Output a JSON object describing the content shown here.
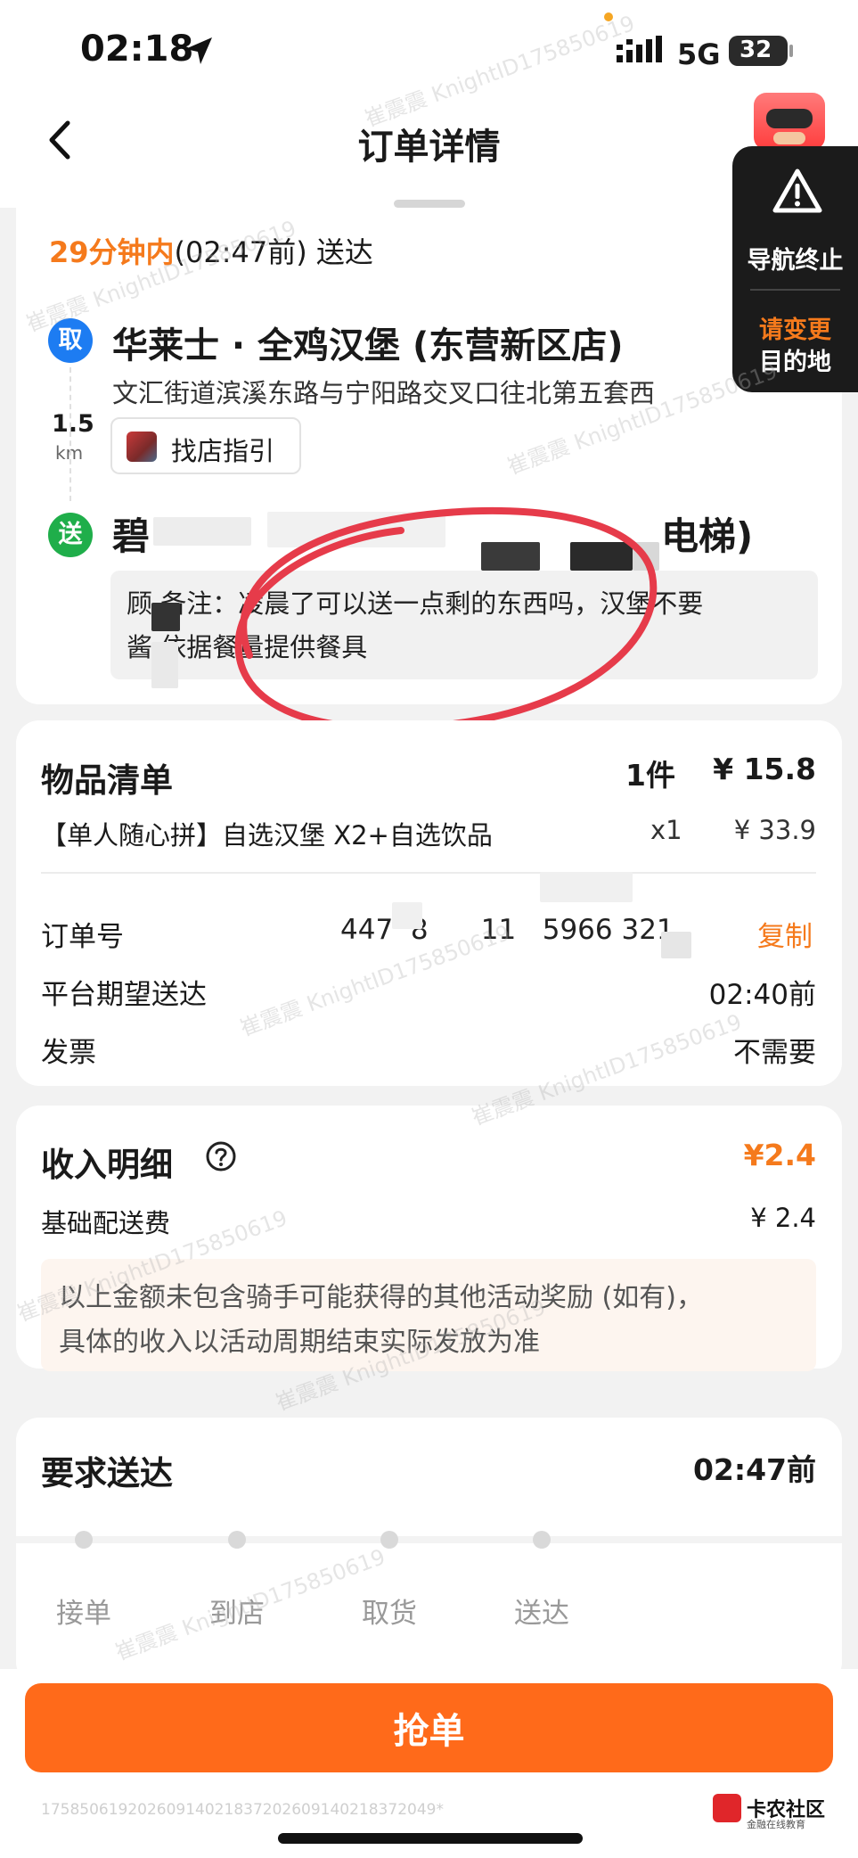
{
  "status_bar": {
    "time": "02:18",
    "network": "5G",
    "battery": "32"
  },
  "header": {
    "title": "订单详情"
  },
  "nav_panel": {
    "end_label": "导航终止",
    "change_label_1": "请变更",
    "change_label_2": "目的地"
  },
  "eta": {
    "highlight": "29分钟内",
    "rest": "(02:47前) 送达"
  },
  "pickup": {
    "badge": "取",
    "name": "华莱士 · 全鸡汉堡 (东营新区店)",
    "address": "文汇街道滨溪东路与宁阳路交叉口往北第五套西",
    "distance": "1.5",
    "distance_unit": "km",
    "guide_label": "找店指引"
  },
  "delivery": {
    "badge": "送",
    "name_head": "碧",
    "name_tail": "电梯)",
    "note_line1": "顾  备注：凌晨了可以送一点剩的东西吗，汉堡不要",
    "note_line2": "酱  依据餐量提供餐具"
  },
  "items": {
    "title": "物品清单",
    "count": "1件",
    "total": "¥ 15.8",
    "rows": [
      {
        "name": "【单人随心拼】自选汉堡 X2+自选饮品",
        "qty": "x1",
        "price": "¥ 33.9"
      }
    ]
  },
  "order_info": {
    "order_no_label": "订单号",
    "order_no_value": "447  8      11   5966 321",
    "copy_label": "复制",
    "expected_label": "平台期望送达",
    "expected_value": "02:40前",
    "invoice_label": "发票",
    "invoice_value": "不需要"
  },
  "income": {
    "title": "收入明细",
    "total": "¥2.4",
    "base_label": "基础配送费",
    "base_value": "¥ 2.4",
    "tip_line1": "以上金额未包含骑手可能获得的其他活动奖励 (如有)，",
    "tip_line2": "具体的收入以活动周期结束实际发放为准"
  },
  "progress": {
    "title": "要求送达",
    "deadline": "02:47前",
    "steps": [
      "接单",
      "到店",
      "取货",
      "送达"
    ]
  },
  "action": {
    "grab_label": "抢单"
  },
  "footer": {
    "id_text": "17585061920260914021837202609140218372049*"
  },
  "watermark": "崔震震 KnightID175850619",
  "logo": {
    "title": "卡农社区",
    "subtitle": "金融在线教育"
  },
  "colors": {
    "accent": "#ff6a1a",
    "eta": "#f57a1c",
    "pickup_badge": "#1d7cf2",
    "delivery_badge": "#1fae4a",
    "annotation": "#e63b4a"
  }
}
